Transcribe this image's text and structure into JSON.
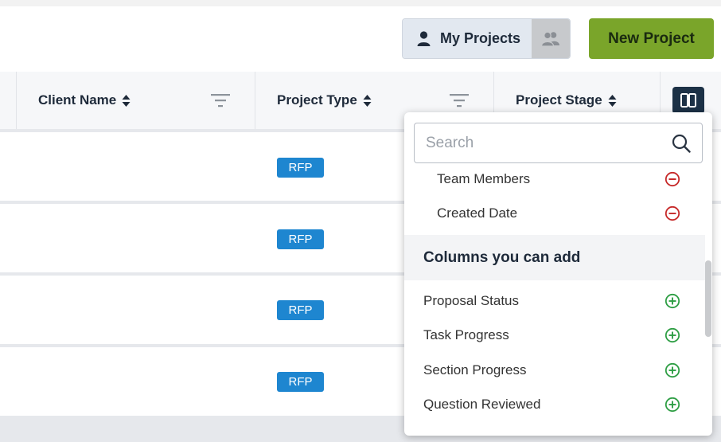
{
  "toolbar": {
    "my_projects_label": "My Projects",
    "new_project_label": "New Project"
  },
  "table": {
    "columns": [
      {
        "label": "Client Name",
        "sortable": true,
        "filterable": true
      },
      {
        "label": "Project Type",
        "sortable": true,
        "filterable": true
      },
      {
        "label": "Project Stage",
        "sortable": true,
        "filterable": false
      }
    ],
    "rows": [
      {
        "project_type": "RFP"
      },
      {
        "project_type": "RFP"
      },
      {
        "project_type": "RFP"
      },
      {
        "project_type": "RFP"
      }
    ]
  },
  "column_picker": {
    "search_placeholder": "Search",
    "current_columns": [
      {
        "label": "Team Members",
        "action": "remove"
      },
      {
        "label": "Created Date",
        "action": "remove"
      }
    ],
    "add_section_title": "Columns you can add",
    "available_columns": [
      {
        "label": "Proposal Status",
        "action": "add"
      },
      {
        "label": "Task Progress",
        "action": "add"
      },
      {
        "label": "Section Progress",
        "action": "add"
      },
      {
        "label": "Question Reviewed",
        "action": "add"
      }
    ]
  },
  "colors": {
    "primary_button": "#7aa52a",
    "badge": "#1e86d0",
    "remove_icon": "#c62828",
    "add_icon": "#2e9e44",
    "column_toggle": "#1c3146"
  }
}
